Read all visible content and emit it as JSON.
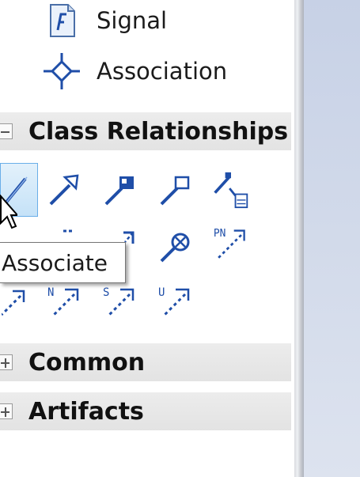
{
  "toolbox": {
    "items": [
      {
        "label": "Signal",
        "icon": "signal-icon"
      },
      {
        "label": "Association",
        "icon": "association-icon"
      }
    ],
    "sections": [
      {
        "title": "Class Relationships",
        "expanded": true,
        "expander": "collapse-icon"
      },
      {
        "title": "Common",
        "expanded": false,
        "expander": "expand-icon"
      },
      {
        "title": "Artifacts",
        "expanded": false,
        "expander": "expand-icon"
      }
    ],
    "relationship_tools": [
      {
        "name": "associate",
        "selected": true
      },
      {
        "name": "generalize"
      },
      {
        "name": "realize"
      },
      {
        "name": "aggregate"
      },
      {
        "name": "compose"
      },
      {
        "name": "trace"
      },
      {
        "name": "abstraction"
      },
      {
        "name": "dependency"
      },
      {
        "name": "usage"
      },
      {
        "name": "nesting"
      },
      {
        "name": "import"
      },
      {
        "name": "merge"
      },
      {
        "name": "substitute"
      },
      {
        "name": "use"
      }
    ],
    "stereotype_marks": {
      "pn": "PN",
      "n": "N",
      "s": "S",
      "u": "U"
    },
    "tooltip": "Associate"
  },
  "colors": {
    "selection_fill": "#c5e2f8",
    "selection_border": "#6aaee8",
    "icon_blue": "#1f4ea8",
    "canvas": "#d2daea"
  }
}
